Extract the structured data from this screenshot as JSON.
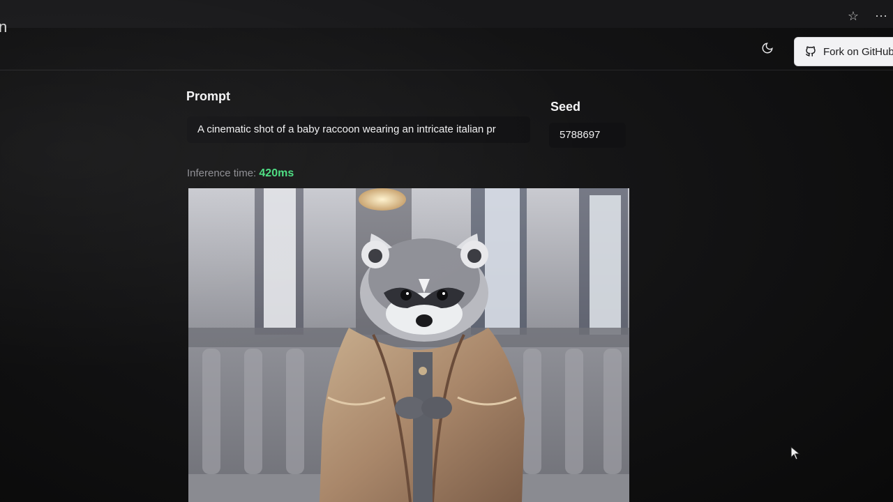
{
  "header": {
    "github_button_label": "Fork on GitHub",
    "icons": [
      "star-icon",
      "more-icon",
      "moon-icon",
      "github-icon"
    ]
  },
  "form": {
    "prompt_label": "Prompt",
    "prompt_value": "A cinematic shot of a baby raccoon wearing an intricate italian pr",
    "seed_label": "Seed",
    "seed_value": "5788697"
  },
  "inference": {
    "label": "Inference time:",
    "value": "420ms",
    "value_color": "#4ade80"
  },
  "image": {
    "subject": "baby raccoon in ornate robe"
  }
}
